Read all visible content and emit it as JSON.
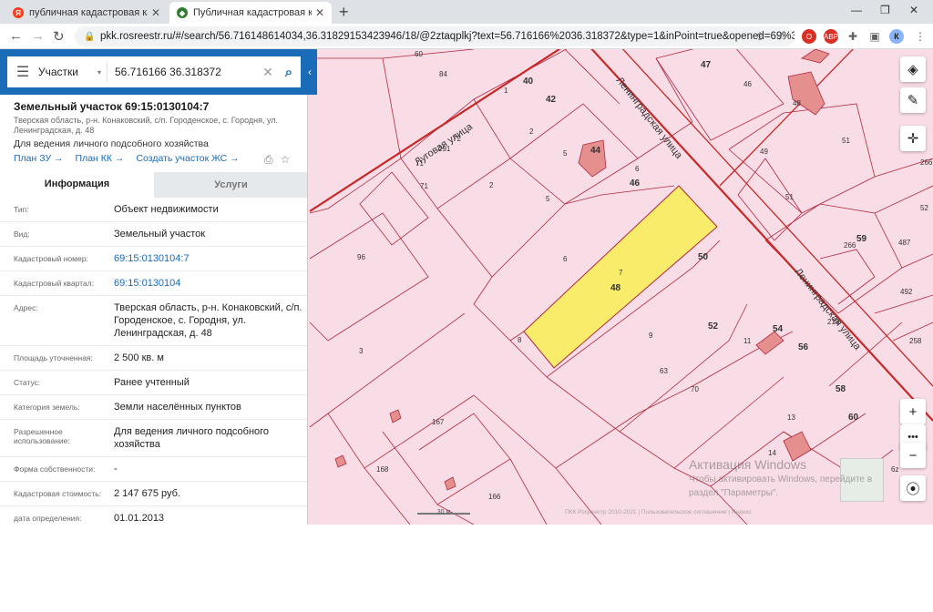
{
  "browser": {
    "tabs": [
      {
        "title": "публичная кадастровая карта –",
        "icon": "yandex-icon"
      },
      {
        "title": "Публичная кадастровая карта",
        "icon": "rosreestr-icon"
      }
    ],
    "url": "pkk.rosreestr.ru/#/search/56.716148614034,36.31829153423946/18/@2ztaqplkj?text=56.716166%2036.318372&type=1&inPoint=true&opened=69%3A...",
    "profile_initial": "К"
  },
  "search": {
    "layer": "Участки",
    "query": "56.716166 36.318372"
  },
  "parcel": {
    "title": "Земельный участок 69:15:0130104:7",
    "address_short": "Тверская область, р-н. Конаковский, с/п. Городенское, с. Городня, ул. Ленинградская, д. 48",
    "use": "Для ведения личного подсобного хозяйства",
    "links": [
      "План ЗУ →",
      "План КК →",
      "Создать участок ЖС →"
    ]
  },
  "tabs": {
    "info": "Информация",
    "services": "Услуги"
  },
  "rows": [
    {
      "label": "Тип:",
      "value": "Объект недвижимости",
      "link": false
    },
    {
      "label": "Вид:",
      "value": "Земельный участок",
      "link": false
    },
    {
      "label": "Кадастровый номер:",
      "value": "69:15:0130104:7",
      "link": true
    },
    {
      "label": "Кадастровый квартал:",
      "value": "69:15:0130104",
      "link": true
    },
    {
      "label": "Адрес:",
      "value": "Тверская область, р-н. Конаковский, с/п. Городенское, с. Городня, ул. Ленинградская, д. 48",
      "link": false
    },
    {
      "label": "Площадь уточненная:",
      "value": "2 500 кв. м",
      "link": false
    },
    {
      "label": "Статус:",
      "value": "Ранее учтенный",
      "link": false
    },
    {
      "label": "Категория земель:",
      "value": "Земли населённых пунктов",
      "link": false
    },
    {
      "label": "Разрешенное использование:",
      "value": "Для ведения личного подсобного хозяйства",
      "link": false
    },
    {
      "label": "Форма собственности:",
      "value": "-",
      "link": false
    },
    {
      "label": "Кадастровая стоимость:",
      "value": "2 147 675 руб.",
      "link": false
    },
    {
      "label": "дата определения:",
      "value": "01.01.2013",
      "link": false
    }
  ],
  "map": {
    "streets": [
      "Луговая улица",
      "Ленинградская улица",
      "Ленинградская улица"
    ],
    "plot_labels": [
      {
        "t": "60",
        "b": false
      },
      {
        "t": "84",
        "b": false
      },
      {
        "t": "40",
        "b": true
      },
      {
        "t": "42",
        "b": true
      },
      {
        "t": "1",
        "b": false
      },
      {
        "t": "2",
        "b": false
      },
      {
        "t": "72",
        "b": false
      },
      {
        "t": "291",
        "b": false
      },
      {
        "t": "71",
        "b": false
      },
      {
        "t": "71",
        "b": false
      },
      {
        "t": "2",
        "b": false
      },
      {
        "t": "5",
        "b": false
      },
      {
        "t": "44",
        "b": true
      },
      {
        "t": "6",
        "b": false
      },
      {
        "t": "46",
        "b": true
      },
      {
        "t": "5",
        "b": false
      },
      {
        "t": "47",
        "b": true
      },
      {
        "t": "46",
        "b": false
      },
      {
        "t": "48",
        "b": false
      },
      {
        "t": "49",
        "b": false
      },
      {
        "t": "51",
        "b": false
      },
      {
        "t": "266",
        "b": false
      },
      {
        "t": "51",
        "b": false
      },
      {
        "t": "52",
        "b": false
      },
      {
        "t": "59",
        "b": true
      },
      {
        "t": "266",
        "b": false
      },
      {
        "t": "487",
        "b": false
      },
      {
        "t": "492",
        "b": false
      },
      {
        "t": "96",
        "b": false
      },
      {
        "t": "6",
        "b": false
      },
      {
        "t": "7",
        "b": false
      },
      {
        "t": "48",
        "b": true
      },
      {
        "t": "50",
        "b": true
      },
      {
        "t": "52",
        "b": true
      },
      {
        "t": "219",
        "b": false
      },
      {
        "t": "258",
        "b": false
      },
      {
        "t": "8",
        "b": false
      },
      {
        "t": "3",
        "b": false
      },
      {
        "t": "9",
        "b": false
      },
      {
        "t": "54",
        "b": true
      },
      {
        "t": "11",
        "b": false
      },
      {
        "t": "56",
        "b": true
      },
      {
        "t": "63",
        "b": false
      },
      {
        "t": "70",
        "b": false
      },
      {
        "t": "58",
        "b": true
      },
      {
        "t": "13",
        "b": false
      },
      {
        "t": "60",
        "b": true
      },
      {
        "t": "167",
        "b": false
      },
      {
        "t": "14",
        "b": false
      },
      {
        "t": "168",
        "b": false
      },
      {
        "t": "166",
        "b": false
      },
      {
        "t": "6z",
        "b": false
      }
    ],
    "scale_label": "30 м",
    "copyright": "ПКК Росреестр 2010-2021 | Пользовательское соглашение | Яндекс"
  },
  "watermark": {
    "line1": "Активация Windows",
    "line2": "Чтобы активировать Windows, перейдите в",
    "line3": "раздел \"Параметры\"."
  }
}
